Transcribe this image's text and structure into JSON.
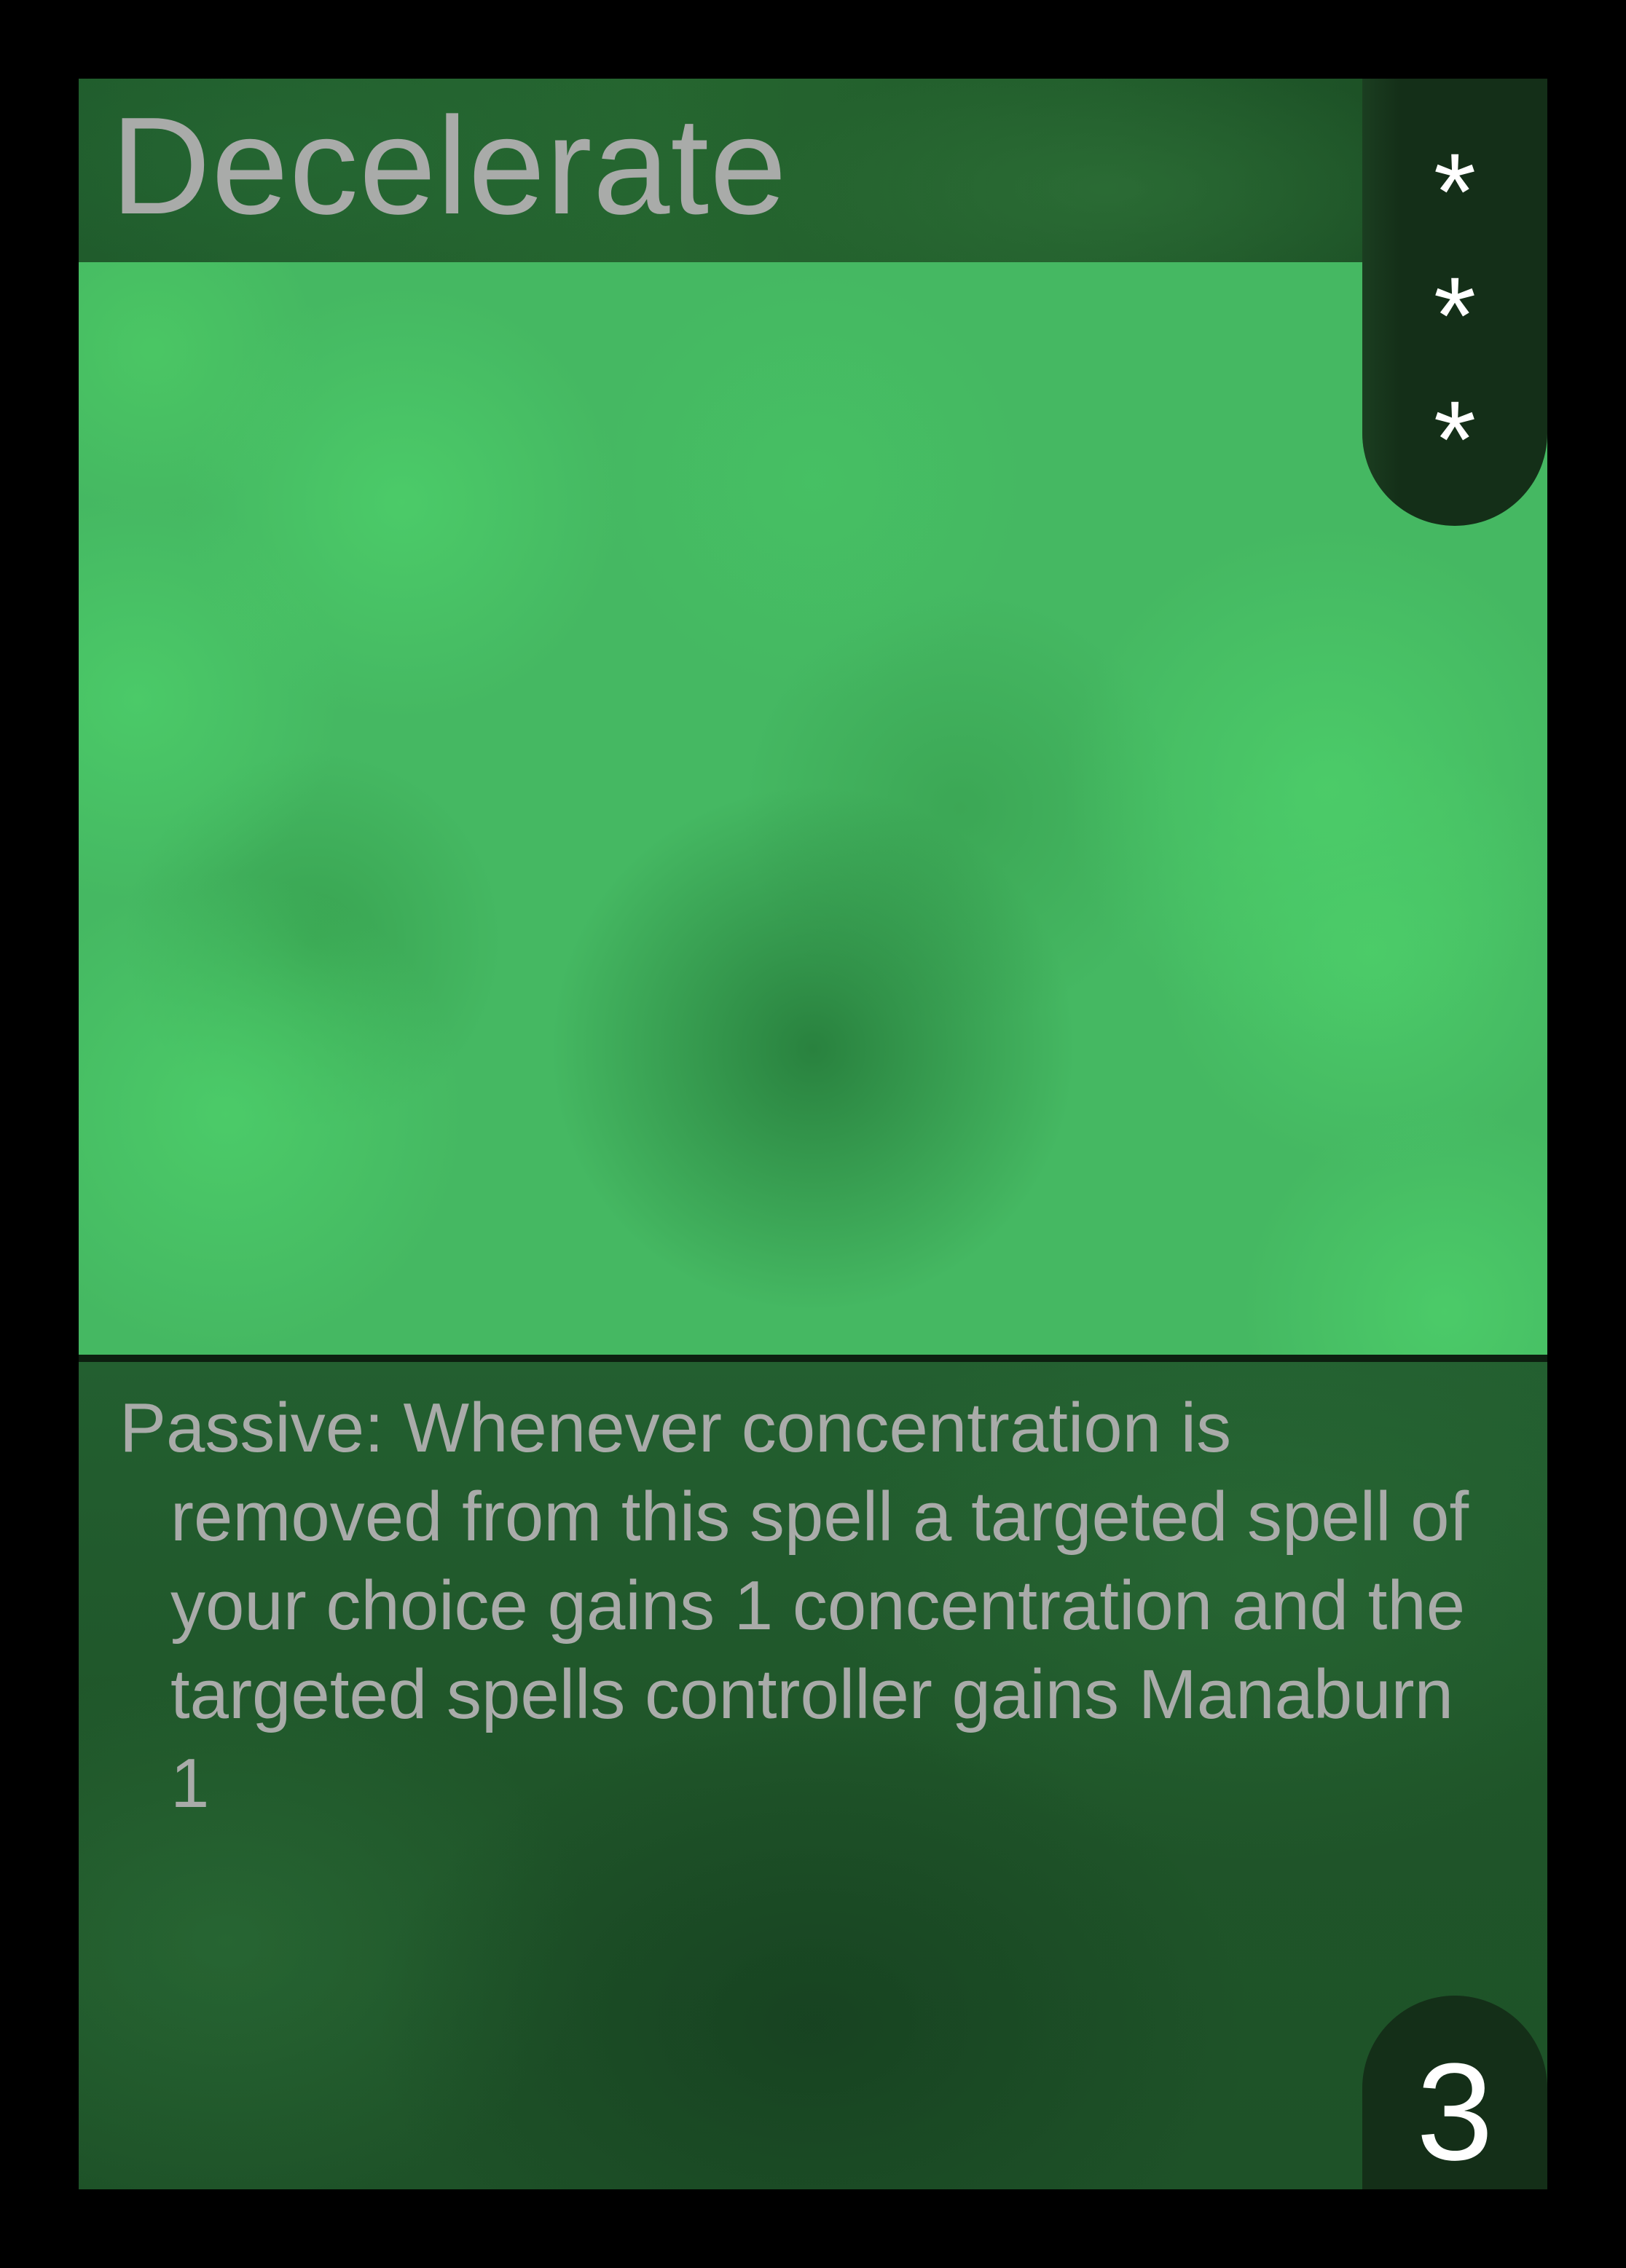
{
  "card": {
    "title": "Decelerate",
    "cost_symbols": [
      "*",
      "*",
      "*"
    ],
    "rules_text": "Passive: Whenever concentration is removed from this spell a targeted spell of your choice gains 1 concentration and the targeted spells controller gains Manaburn 1",
    "level": "3",
    "colors": {
      "frame": "#000000",
      "title_bar": "#235f2e",
      "art_base": "#45b862",
      "text_box": "#1f5529",
      "tab": "#142f18",
      "text": "#a9aba9",
      "symbol": "#ffffff"
    }
  }
}
